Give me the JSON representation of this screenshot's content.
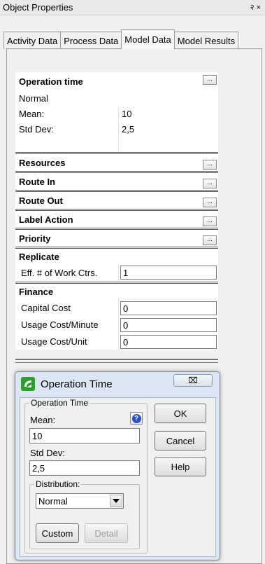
{
  "window": {
    "title": "Object Properties",
    "pin_glyph": "२ ×"
  },
  "tabs": [
    {
      "label": "Activity Data"
    },
    {
      "label": "Process Data"
    },
    {
      "label": "Model Data",
      "active": true
    },
    {
      "label": "Model Results"
    }
  ],
  "grid": {
    "operation_time": {
      "label": "Operation time",
      "distribution": "Normal",
      "mean_label": "Mean:",
      "mean_value": "10",
      "stddev_label": "Std Dev:",
      "stddev_value": "2,5"
    },
    "resources": "Resources",
    "route_in": "Route In",
    "route_out": "Route Out",
    "label_action": "Label Action",
    "priority": "Priority",
    "replicate": {
      "label": "Replicate",
      "eff_label": "Eff. # of Work Ctrs.",
      "eff_value": "1"
    },
    "finance": {
      "label": "Finance",
      "capital_label": "Capital Cost",
      "capital_value": "0",
      "usage_min_label": "Usage Cost/Minute",
      "usage_min_value": "0",
      "usage_unit_label": "Usage Cost/Unit",
      "usage_unit_value": "0"
    },
    "ellipsis": "..."
  },
  "dialog": {
    "title": "Operation Time",
    "close_glyph": "⌧",
    "group_label": "Operation Time",
    "mean_label": "Mean:",
    "mean_value": "10",
    "stddev_label": "Std Dev:",
    "stddev_value": "2,5",
    "distribution_label": "Distribution:",
    "distribution_value": "Normal",
    "help_glyph": "?",
    "buttons": {
      "ok": "OK",
      "cancel": "Cancel",
      "help": "Help",
      "custom": "Custom",
      "detail": "Detail"
    }
  },
  "colors": {
    "accent_green": "#2f9e2f",
    "help_blue": "#2a4fc1",
    "dialog_frame": "#dbe6f2"
  }
}
